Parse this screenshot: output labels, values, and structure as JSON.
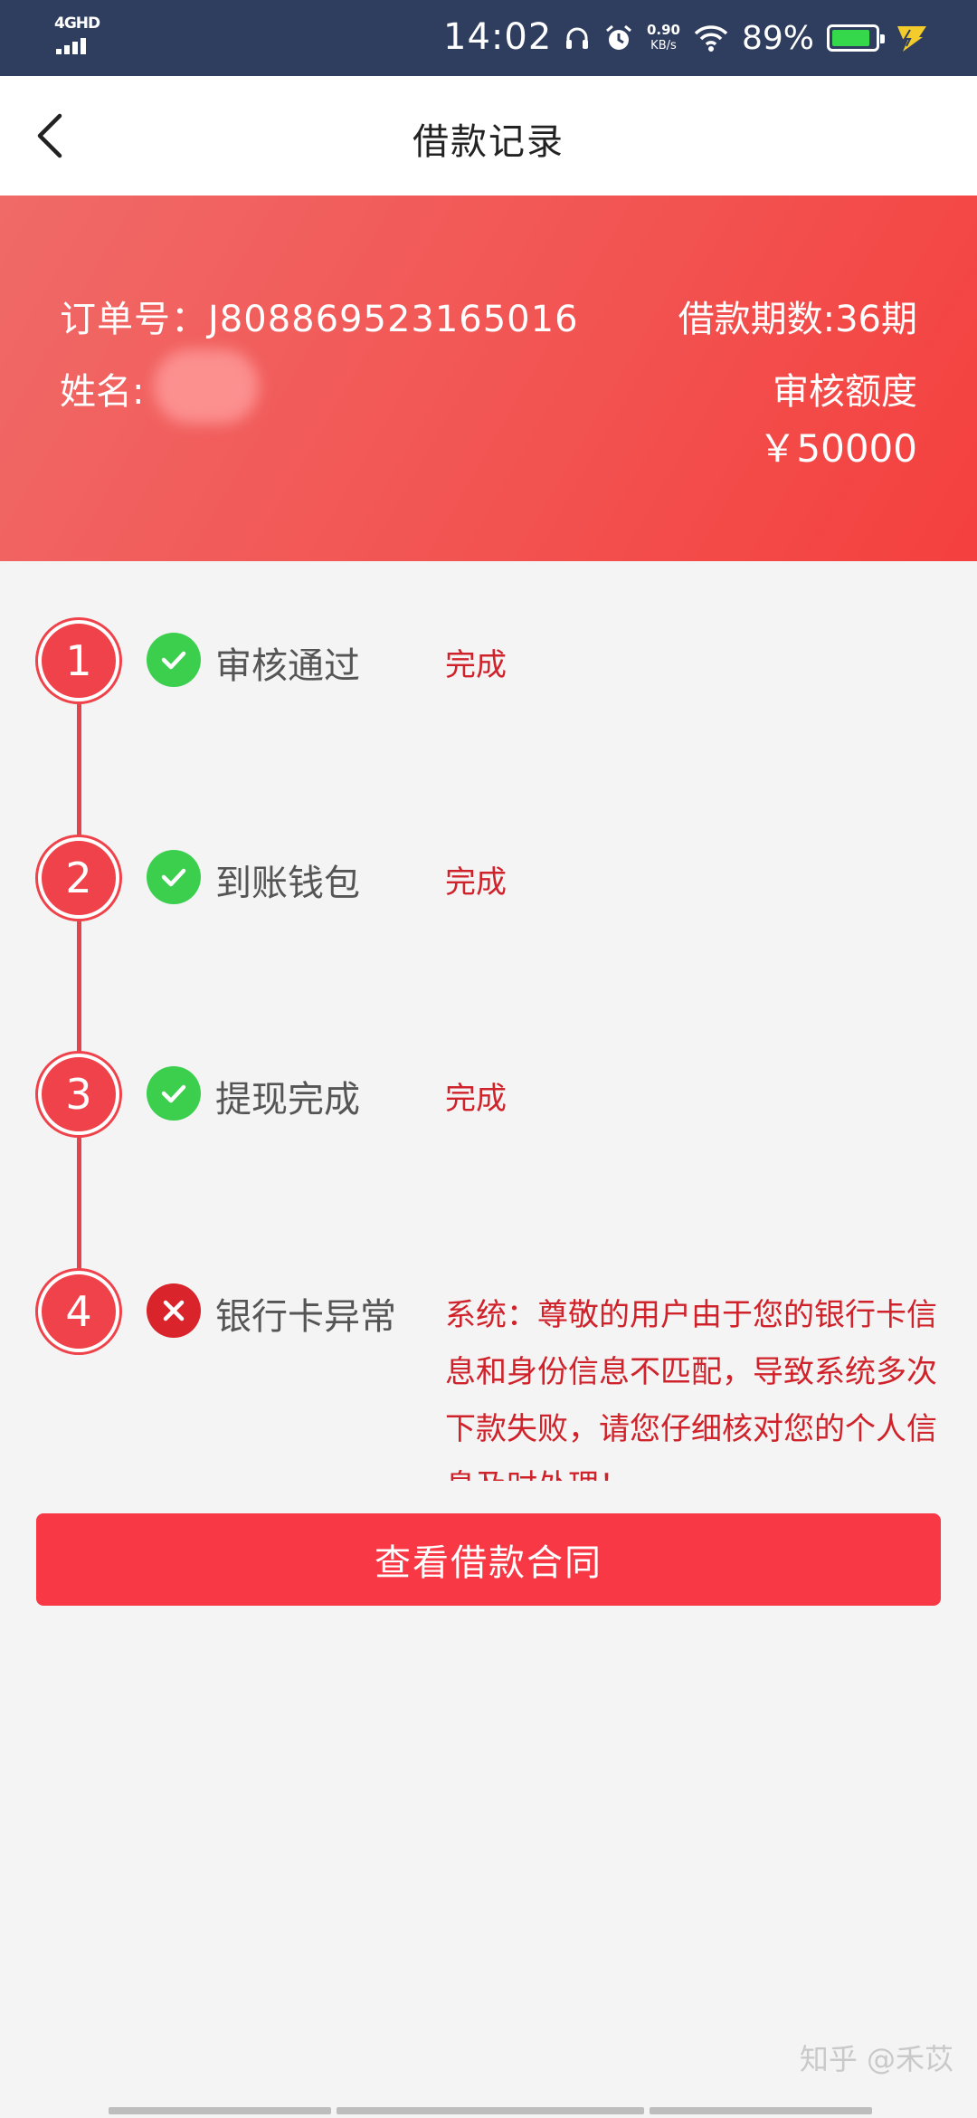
{
  "status_bar": {
    "network": "4GHD",
    "time": "14:02",
    "speed_value": "0.90",
    "speed_unit": "KB/s",
    "battery_pct": "89%",
    "battery_level": 0.89,
    "icons": [
      "headphone-icon",
      "alarm-icon",
      "wifi-icon",
      "battery-icon",
      "charging-bolt-icon"
    ]
  },
  "header": {
    "title": "借款记录",
    "back_icon": "chevron-left-icon"
  },
  "summary": {
    "order_no": "订单号：J808869523165016",
    "name_label": "姓名:",
    "period": "借款期数:36期",
    "quota_label": "审核额度",
    "quota_value": "￥50000"
  },
  "steps": [
    {
      "number": "1",
      "label": "审核通过",
      "status": "完成",
      "state": "ok"
    },
    {
      "number": "2",
      "label": "到账钱包",
      "status": "完成",
      "state": "ok"
    },
    {
      "number": "3",
      "label": "提现完成",
      "status": "完成",
      "state": "ok"
    },
    {
      "number": "4",
      "label": "银行卡异常",
      "status": "系统：尊敬的用户由于您的银行卡信息和身份信息不匹配，导致系统多次下款失败，请您仔细核对您的个人信息及时处理！",
      "state": "error"
    }
  ],
  "actions": {
    "view_contract": "查看借款合同"
  },
  "watermark": "知乎 @禾苡",
  "colors": {
    "status_bar": "#2f3e5e",
    "banner": "#f25452",
    "accent_red": "#f0424a",
    "status_text": "#d0222a",
    "ok_green": "#3ccf4e",
    "button": "#f93846"
  }
}
